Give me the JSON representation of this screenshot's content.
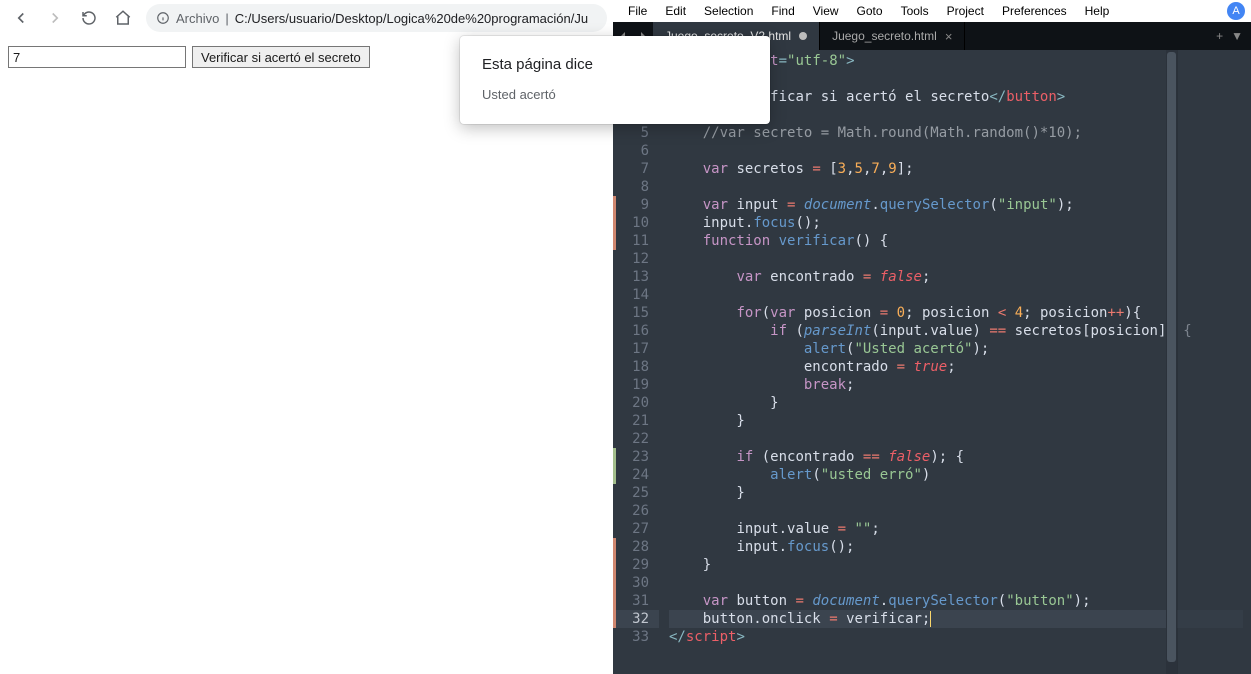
{
  "browser": {
    "address_prefix": "Archivo",
    "address_url": "C:/Users/usuario/Desktop/Logica%20de%20programación/Ju",
    "input_value": "7",
    "verify_button": "Verificar si acertó el secreto",
    "alert_title": "Esta página dice",
    "alert_message": "Usted acertó"
  },
  "sublime": {
    "menu": [
      "File",
      "Edit",
      "Selection",
      "Find",
      "View",
      "Goto",
      "Tools",
      "Project",
      "Preferences",
      "Help"
    ],
    "avatar": "A",
    "tabs": [
      {
        "label": "Juego_secreto_V2.html",
        "active": true,
        "dirty": true
      },
      {
        "label": "Juego_secreto.html",
        "active": false,
        "dirty": false
      }
    ],
    "tab_plus": "+",
    "tab_dd": "▼",
    "code": {
      "line_count": 33,
      "selected_line": 32,
      "markers_orange": [
        3,
        4,
        9,
        10,
        11,
        28,
        29,
        30,
        31,
        32
      ],
      "markers_green": [
        23,
        24
      ]
    }
  }
}
